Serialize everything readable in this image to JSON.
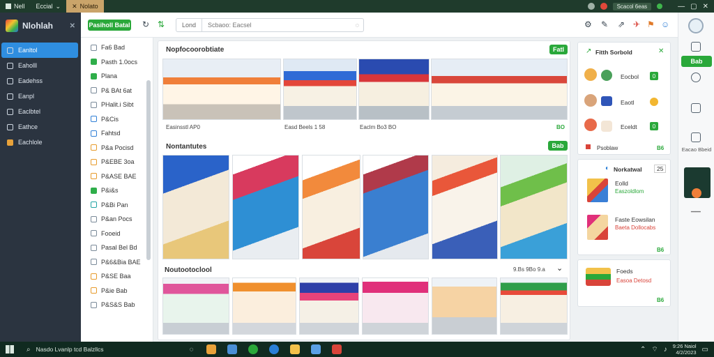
{
  "titlebar": {
    "tabs": [
      "Nell",
      "Eccial"
    ],
    "active_tab": "Nolato",
    "account_label": "Scacol 6eas"
  },
  "sidebar": {
    "brand": "Nlohlah",
    "items": [
      {
        "label": "Eanltol",
        "active": true
      },
      {
        "label": "Eaholll",
        "active": false
      },
      {
        "label": "Eadehss",
        "active": false
      },
      {
        "label": "Eanpl",
        "active": false
      },
      {
        "label": "Eaclbtel",
        "active": false
      },
      {
        "label": "Eathce",
        "active": false
      },
      {
        "label": "Eachlole",
        "active": false
      }
    ]
  },
  "subnav": {
    "items": [
      "Fa6 Bad",
      "Pasth 1.0ocs",
      "Plana",
      "P& BAt 6at",
      "PHalit.i Sibt",
      "P&Cis",
      "Fahtsd",
      "P&a Pocisd",
      "P&EBE 3oa",
      "P&ASE BAE",
      "P&i&s",
      "P&Bi Pan",
      "P&an Pocs",
      "Fooeid",
      "Pasal Bel Bd",
      "P&6&Bia BAE",
      "P&SE Baa",
      "P&ie Bab",
      "P&S&S Bab"
    ]
  },
  "toolbar": {
    "primary_button": "Pasiholl Batal",
    "search_category": "Lond",
    "search_placeholder": "Scbaoo: Eacsel"
  },
  "main": {
    "section1": {
      "title": "Nopfocoorobtiate",
      "button": "Fatl",
      "captions": [
        "Easinsstl AP0",
        "Easd Beels 1 58",
        "Eaclm Bo3 BO"
      ],
      "end_tag": "BO"
    },
    "section2": {
      "title": "Nontantutes",
      "button": "Bab"
    },
    "section3": {
      "title": "Noutootoclool",
      "meta": "9.Bs 9Bo 9.a",
      "chevron": "⌄"
    }
  },
  "right_panel": {
    "card1": {
      "title": "Fitth Sorbold",
      "rows": [
        {
          "label": "Eocbol",
          "value": "0",
          "control": "toggle"
        },
        {
          "label": "Eaotl",
          "control": "coin"
        },
        {
          "label": "Eceldt",
          "value": "0",
          "control": "toggle"
        }
      ],
      "footer": "Psoblaw",
      "footer_tag": "B6"
    },
    "card2": {
      "title": "Norkatwal",
      "count": "25",
      "items": [
        {
          "title": "Eolld",
          "subtitle": "Easzoldlom"
        },
        {
          "title": "Faste Eowsilan",
          "subtitle": "Baeta Dollocabs"
        }
      ],
      "footer_tag": "B6"
    },
    "card3": {
      "title": "Foeds",
      "subtitle": "Easoa Detosd",
      "footer_tag": "B6"
    }
  },
  "rail": {
    "button": "Bab",
    "labels": [
      "Eacao Bbeid"
    ]
  },
  "taskbar": {
    "search_text": "Nasdo Lvanlp tcd Balzllcs",
    "time": "9:26 Naiol",
    "date": "4/2/2023"
  },
  "colors": {
    "accent_green": "#2aa83a",
    "sidebar_active": "#2f8ee0",
    "sidebar_bg": "#2b3440",
    "titlebar_bg": "#1f3b2c",
    "taskbar_bg": "#102a20"
  }
}
